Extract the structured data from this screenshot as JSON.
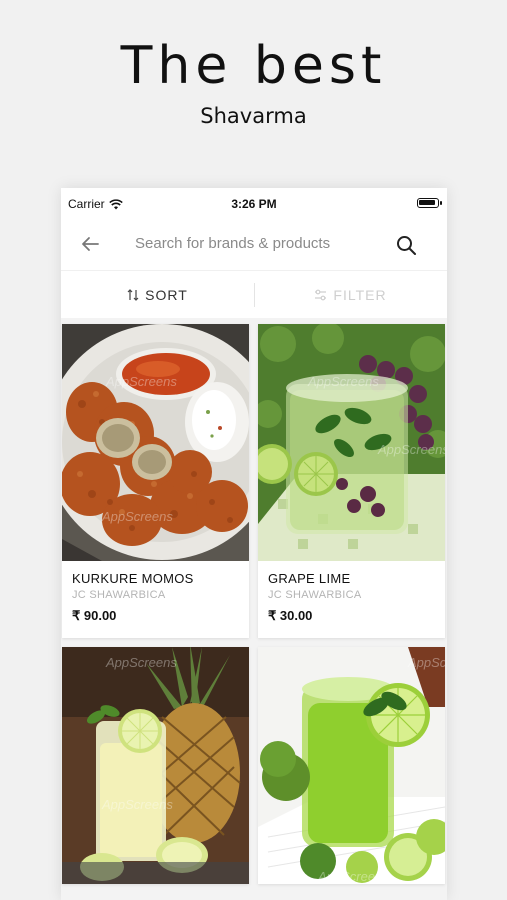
{
  "promo": {
    "headline": "The best",
    "subheadline": "Shavarma"
  },
  "status_bar": {
    "carrier": "Carrier",
    "time": "3:26 PM",
    "wifi_icon": "wifi-icon",
    "battery_icon": "battery-icon"
  },
  "search": {
    "placeholder": "Search for brands & products",
    "back_icon": "back-arrow-icon",
    "search_icon": "search-icon"
  },
  "toolbar": {
    "sort_label": "SORT",
    "filter_label": "FILTER"
  },
  "products": [
    {
      "name": "KURKURE MOMOS",
      "brand": "JC SHAWARBICA",
      "price": "₹ 90.00"
    },
    {
      "name": "GRAPE LIME",
      "brand": "JC SHAWARBICA",
      "price": "₹ 30.00"
    }
  ],
  "watermark": "AppScreens",
  "colors": {
    "background": "#f1f1f1",
    "card": "#ffffff",
    "muted_text": "#b4b4b4",
    "disabled_text": "#cfcfcf"
  }
}
